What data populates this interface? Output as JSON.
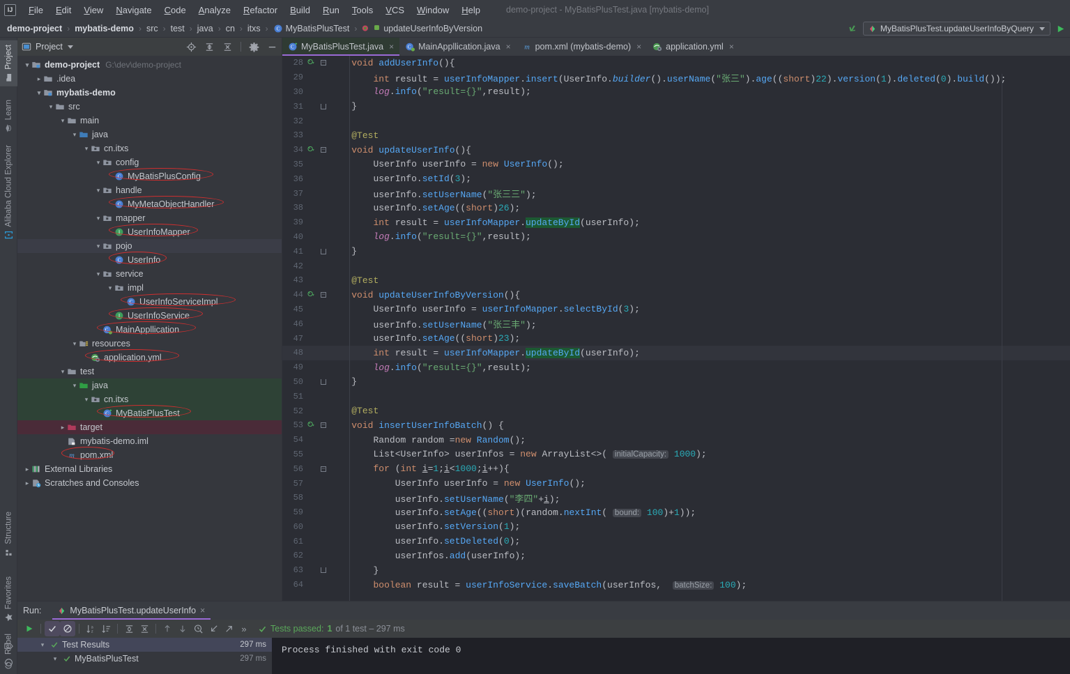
{
  "window": {
    "title": "demo-project - MyBatisPlusTest.java [mybatis-demo]"
  },
  "menubar": {
    "logo": "ij-logo",
    "items": [
      "File",
      "Edit",
      "View",
      "Navigate",
      "Code",
      "Analyze",
      "Refactor",
      "Build",
      "Run",
      "Tools",
      "VCS",
      "Window",
      "Help"
    ]
  },
  "breadcrumb": {
    "items": [
      {
        "label": "demo-project",
        "bold": true,
        "icon": ""
      },
      {
        "label": "mybatis-demo",
        "bold": true,
        "icon": ""
      },
      {
        "label": "src",
        "bold": false,
        "icon": ""
      },
      {
        "label": "test",
        "bold": false,
        "icon": ""
      },
      {
        "label": "java",
        "bold": false,
        "icon": ""
      },
      {
        "label": "cn",
        "bold": false,
        "icon": ""
      },
      {
        "label": "itxs",
        "bold": false,
        "icon": ""
      },
      {
        "label": "MyBatisPlusTest",
        "bold": false,
        "icon": "class-icon"
      },
      {
        "label": "updateUserInfoByVersion",
        "bold": false,
        "icon": "method-icon"
      }
    ],
    "separator": "›"
  },
  "toolbar_right": {
    "back_icon": "hook-arrow-icon",
    "run_config": "MyBatisPlusTest.updateUserInfoByQuery",
    "run_config_icon": "run-config-icon",
    "dropdown_icon": "chevron-down-icon",
    "run_icon": "run-play-icon"
  },
  "left_strip": {
    "top": [
      {
        "label": "Project",
        "icon": "project-folder-icon",
        "active": true
      },
      {
        "label": "Learn",
        "icon": "learn-hat-icon",
        "active": false
      },
      {
        "label": "Alibaba Cloud Explorer",
        "icon": "cloud-bracket-icon",
        "active": false
      }
    ],
    "bottom": [
      {
        "label": "Structure",
        "icon": "structure-icon"
      },
      {
        "label": "Favorites",
        "icon": "star-icon"
      },
      {
        "label": "Rebel",
        "icon": "rebel-icon"
      }
    ]
  },
  "project_panel": {
    "title": "Project",
    "title_icon": "project-icon",
    "dropdown_icon": "chevron-down-icon",
    "tools": [
      "locate-icon",
      "expand-all-icon",
      "collapse-all-icon",
      "gear-icon",
      "hide-icon"
    ],
    "tree": [
      {
        "depth": 0,
        "label": "demo-project",
        "note": "G:\\dev\\demo-project",
        "icon": "module-folder-icon",
        "twisty": "down",
        "bold": true,
        "bg": ""
      },
      {
        "depth": 1,
        "label": ".idea",
        "note": "",
        "icon": "folder-icon",
        "twisty": "right",
        "bold": false,
        "bg": ""
      },
      {
        "depth": 1,
        "label": "mybatis-demo",
        "note": "",
        "icon": "module-folder-icon",
        "twisty": "down",
        "bold": true,
        "bg": ""
      },
      {
        "depth": 2,
        "label": "src",
        "note": "",
        "icon": "folder-icon",
        "twisty": "down",
        "bold": false,
        "bg": ""
      },
      {
        "depth": 3,
        "label": "main",
        "note": "",
        "icon": "folder-icon",
        "twisty": "down",
        "bold": false,
        "bg": ""
      },
      {
        "depth": 4,
        "label": "java",
        "note": "",
        "icon": "source-folder-icon",
        "twisty": "down",
        "bold": false,
        "bg": ""
      },
      {
        "depth": 5,
        "label": "cn.itxs",
        "note": "",
        "icon": "package-icon",
        "twisty": "down",
        "bold": false,
        "bg": ""
      },
      {
        "depth": 6,
        "label": "config",
        "note": "",
        "icon": "package-icon",
        "twisty": "down",
        "bold": false,
        "bg": ""
      },
      {
        "depth": 7,
        "label": "MyBatisPlusConfig",
        "note": "",
        "icon": "class-icon",
        "twisty": "",
        "bold": false,
        "bg": "",
        "circled": true
      },
      {
        "depth": 6,
        "label": "handle",
        "note": "",
        "icon": "package-icon",
        "twisty": "down",
        "bold": false,
        "bg": ""
      },
      {
        "depth": 7,
        "label": "MyMetaObjectHandler",
        "note": "",
        "icon": "class-icon",
        "twisty": "",
        "bold": false,
        "bg": "",
        "circled": true
      },
      {
        "depth": 6,
        "label": "mapper",
        "note": "",
        "icon": "package-icon",
        "twisty": "down",
        "bold": false,
        "bg": ""
      },
      {
        "depth": 7,
        "label": "UserInfoMapper",
        "note": "",
        "icon": "interface-icon",
        "twisty": "",
        "bold": false,
        "bg": "",
        "circled": true
      },
      {
        "depth": 6,
        "label": "pojo",
        "note": "",
        "icon": "package-icon",
        "twisty": "down",
        "bold": false,
        "bg": "selected"
      },
      {
        "depth": 7,
        "label": "UserInfo",
        "note": "",
        "icon": "class-icon",
        "twisty": "",
        "bold": false,
        "bg": "",
        "circled": true
      },
      {
        "depth": 6,
        "label": "service",
        "note": "",
        "icon": "package-icon",
        "twisty": "down",
        "bold": false,
        "bg": ""
      },
      {
        "depth": 7,
        "label": "impl",
        "note": "",
        "icon": "package-icon",
        "twisty": "down",
        "bold": false,
        "bg": ""
      },
      {
        "depth": 8,
        "label": "UserInfoServiceImpl",
        "note": "",
        "icon": "class-icon",
        "twisty": "",
        "bold": false,
        "bg": "",
        "circled": true
      },
      {
        "depth": 7,
        "label": "UserInfoService",
        "note": "",
        "icon": "interface-icon",
        "twisty": "",
        "bold": false,
        "bg": "",
        "circled": true
      },
      {
        "depth": 6,
        "label": "MainAppllication",
        "note": "",
        "icon": "spring-class-icon",
        "twisty": "",
        "bold": false,
        "bg": "",
        "circled": true
      },
      {
        "depth": 4,
        "label": "resources",
        "note": "",
        "icon": "resources-folder-icon",
        "twisty": "down",
        "bold": false,
        "bg": ""
      },
      {
        "depth": 5,
        "label": "application.yml",
        "note": "",
        "icon": "spring-yml-icon",
        "twisty": "",
        "bold": false,
        "bg": "",
        "circled": true
      },
      {
        "depth": 3,
        "label": "test",
        "note": "",
        "icon": "folder-icon",
        "twisty": "down",
        "bold": false,
        "bg": ""
      },
      {
        "depth": 4,
        "label": "java",
        "note": "",
        "icon": "test-source-folder-icon",
        "twisty": "down",
        "bold": false,
        "bg": "green"
      },
      {
        "depth": 5,
        "label": "cn.itxs",
        "note": "",
        "icon": "package-icon",
        "twisty": "down",
        "bold": false,
        "bg": "green"
      },
      {
        "depth": 6,
        "label": "MyBatisPlusTest",
        "note": "",
        "icon": "test-class-icon",
        "twisty": "",
        "bold": false,
        "bg": "green",
        "circled": true
      },
      {
        "depth": 3,
        "label": "target",
        "note": "",
        "icon": "excluded-folder-icon",
        "twisty": "right",
        "bold": false,
        "bg": "red"
      },
      {
        "depth": 3,
        "label": "mybatis-demo.iml",
        "note": "",
        "icon": "iml-icon",
        "twisty": "",
        "bold": false,
        "bg": ""
      },
      {
        "depth": 3,
        "label": "pom.xml",
        "note": "",
        "icon": "maven-icon",
        "twisty": "",
        "bold": false,
        "bg": "",
        "circled": true
      },
      {
        "depth": 0,
        "label": "External Libraries",
        "note": "",
        "icon": "libraries-icon",
        "twisty": "right",
        "bold": false,
        "bg": ""
      },
      {
        "depth": 0,
        "label": "Scratches and Consoles",
        "note": "",
        "icon": "scratches-icon",
        "twisty": "right",
        "bold": false,
        "bg": ""
      }
    ]
  },
  "editor": {
    "tabs": [
      {
        "label": "MyBatisPlusTest.java",
        "icon": "test-class-icon",
        "active": true,
        "close": "×"
      },
      {
        "label": "MainAppllication.java",
        "icon": "spring-class-icon",
        "active": false,
        "close": "×"
      },
      {
        "label": "pom.xml (mybatis-demo)",
        "icon": "maven-icon",
        "active": false,
        "close": "×"
      },
      {
        "label": "application.yml",
        "icon": "spring-yml-icon",
        "active": false,
        "close": "×"
      }
    ],
    "first_line": 28,
    "highlighted_line": 48,
    "lines": [
      {
        "n": 28,
        "run": true,
        "fold": "end-top",
        "text": "    void addUserInfo(){"
      },
      {
        "n": 29,
        "run": false,
        "fold": "",
        "text": "        int result = userInfoMapper.insert(UserInfo.builder().userName(\"张三\").age((short)22).version(1).deleted(0).build());"
      },
      {
        "n": 30,
        "run": false,
        "fold": "",
        "text": "        log.info(\"result={}\",result);"
      },
      {
        "n": 31,
        "run": false,
        "fold": "end",
        "text": "    }"
      },
      {
        "n": 32,
        "run": false,
        "fold": "",
        "text": ""
      },
      {
        "n": 33,
        "run": false,
        "fold": "",
        "text": "    @Test"
      },
      {
        "n": 34,
        "run": true,
        "fold": "start",
        "text": "    void updateUserInfo(){"
      },
      {
        "n": 35,
        "run": false,
        "fold": "",
        "text": "        UserInfo userInfo = new UserInfo();"
      },
      {
        "n": 36,
        "run": false,
        "fold": "",
        "text": "        userInfo.setId(3);"
      },
      {
        "n": 37,
        "run": false,
        "fold": "",
        "text": "        userInfo.setUserName(\"张三三\");"
      },
      {
        "n": 38,
        "run": false,
        "fold": "",
        "text": "        userInfo.setAge((short)26);"
      },
      {
        "n": 39,
        "run": false,
        "fold": "",
        "text": "        int result = userInfoMapper.updateById(userInfo);"
      },
      {
        "n": 40,
        "run": false,
        "fold": "",
        "text": "        log.info(\"result={}\",result);"
      },
      {
        "n": 41,
        "run": false,
        "fold": "end",
        "text": "    }"
      },
      {
        "n": 42,
        "run": false,
        "fold": "",
        "text": ""
      },
      {
        "n": 43,
        "run": false,
        "fold": "",
        "text": "    @Test"
      },
      {
        "n": 44,
        "run": true,
        "fold": "start",
        "text": "    void updateUserInfoByVersion(){"
      },
      {
        "n": 45,
        "run": false,
        "fold": "",
        "text": "        UserInfo userInfo = userInfoMapper.selectById(3);"
      },
      {
        "n": 46,
        "run": false,
        "fold": "",
        "text": "        userInfo.setUserName(\"张三丰\");"
      },
      {
        "n": 47,
        "run": false,
        "fold": "",
        "text": "        userInfo.setAge((short)23);"
      },
      {
        "n": 48,
        "run": false,
        "fold": "",
        "text": "        int result = userInfoMapper.updateById(userInfo);"
      },
      {
        "n": 49,
        "run": false,
        "fold": "",
        "text": "        log.info(\"result={}\",result);"
      },
      {
        "n": 50,
        "run": false,
        "fold": "end",
        "text": "    }"
      },
      {
        "n": 51,
        "run": false,
        "fold": "",
        "text": ""
      },
      {
        "n": 52,
        "run": false,
        "fold": "",
        "text": "    @Test"
      },
      {
        "n": 53,
        "run": true,
        "fold": "start",
        "text": "    void insertUserInfoBatch() {"
      },
      {
        "n": 54,
        "run": false,
        "fold": "",
        "text": "        Random random =new Random();"
      },
      {
        "n": 55,
        "run": false,
        "fold": "",
        "text": "        List<UserInfo> userInfos = new ArrayList<>( initialCapacity: 1000);"
      },
      {
        "n": 56,
        "run": false,
        "fold": "start",
        "text": "        for (int i=1;i<1000;i++){"
      },
      {
        "n": 57,
        "run": false,
        "fold": "",
        "text": "            UserInfo userInfo = new UserInfo();"
      },
      {
        "n": 58,
        "run": false,
        "fold": "",
        "text": "            userInfo.setUserName(\"李四\"+i);"
      },
      {
        "n": 59,
        "run": false,
        "fold": "",
        "text": "            userInfo.setAge((short)(random.nextInt( bound: 100)+1));"
      },
      {
        "n": 60,
        "run": false,
        "fold": "",
        "text": "            userInfo.setVersion(1);"
      },
      {
        "n": 61,
        "run": false,
        "fold": "",
        "text": "            userInfo.setDeleted(0);"
      },
      {
        "n": 62,
        "run": false,
        "fold": "",
        "text": "            userInfos.add(userInfo);"
      },
      {
        "n": 63,
        "run": false,
        "fold": "end",
        "text": "        }"
      },
      {
        "n": 64,
        "run": false,
        "fold": "",
        "text": "        boolean result = userInfoService.saveBatch(userInfos,  batchSize: 100);"
      }
    ]
  },
  "run_panel": {
    "label": "Run:",
    "tab": "MyBatisPlusTest.updateUserInfo",
    "tab_icon": "run-config-icon",
    "tab_close": "×",
    "toolbar": [
      "rerun-icon",
      "show-passed-icon",
      "ignore-tests-icon",
      "sort-alpha-icon",
      "sort-duration-icon",
      "expand-all-icon",
      "collapse-all-icon",
      "prev-icon",
      "next-icon",
      "history-icon",
      "import-icon",
      "export-icon",
      "more-icon"
    ],
    "status_prefix": "Tests passed:",
    "status_count": "1",
    "status_suffix": "of 1 test – 297 ms",
    "gutter_icons": [
      "pin-icon",
      "rerun-auto-icon"
    ],
    "tree": [
      {
        "depth": 0,
        "label": "Test Results",
        "duration": "297 ms",
        "twisty": "down",
        "selected": true
      },
      {
        "depth": 1,
        "label": "MyBatisPlusTest",
        "duration": "297 ms",
        "twisty": "down",
        "selected": false
      }
    ],
    "console": "Process finished with exit code 0"
  },
  "colors": {
    "accent_purple": "#9a6ad6",
    "pass_green": "#5aa85a",
    "annotation_red": "#cf2f2f",
    "test_source_green": "#2e4236",
    "excluded_red": "#4a2b38",
    "keyword": "#cf8e6d",
    "string": "#6aab73",
    "number": "#2aacb8",
    "method": "#56a8f5",
    "field": "#c77dbb"
  }
}
